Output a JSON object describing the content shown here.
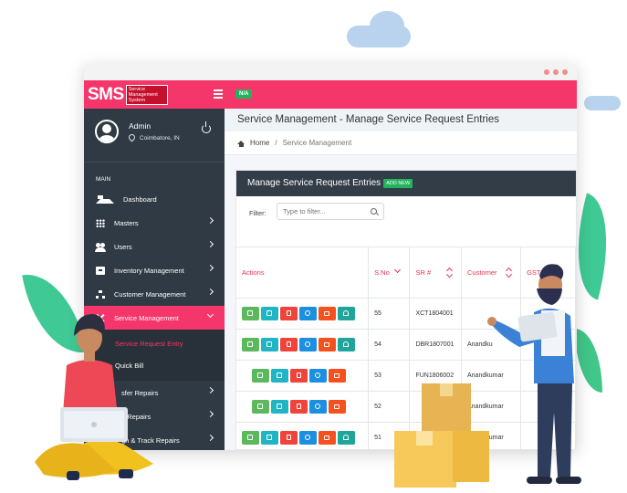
{
  "app": {
    "logo_text": "SMS",
    "logo_subtitle": "Service Management System",
    "status_badge": "N/A"
  },
  "profile": {
    "name": "Admin",
    "location": "Coimbatore, IN"
  },
  "sidebar": {
    "section_label": "MAIN",
    "items": [
      {
        "label": "Dashboard"
      },
      {
        "label": "Masters"
      },
      {
        "label": "Users"
      },
      {
        "label": "Inventory Management"
      },
      {
        "label": "Customer Management"
      },
      {
        "label": "Service Management"
      }
    ],
    "sub_items": [
      {
        "label": "Service Request Entry"
      },
      {
        "label": "Quick Bill"
      }
    ],
    "partial_items": [
      {
        "label": "sfer Repairs"
      },
      {
        "label": "e Repairs"
      },
      {
        "label": "gn & Track Repairs"
      }
    ]
  },
  "page": {
    "title": "Service Management - Manage Service Request Entries",
    "breadcrumb_home": "Home",
    "breadcrumb_sep": "/",
    "breadcrumb_current": "Service Management"
  },
  "card": {
    "title": "Manage Service Request Entries",
    "add_new_label": "ADD NEW",
    "filter_label": "Filter:",
    "filter_placeholder": "Type to filter..."
  },
  "table": {
    "columns": [
      "Actions",
      "S.No",
      "SR #",
      "Customer",
      "GST"
    ],
    "rows": [
      {
        "sno": "55",
        "sr": "XCT1804001",
        "customer": ""
      },
      {
        "sno": "54",
        "sr": "DBR1807001",
        "customer": "Anandku"
      },
      {
        "sno": "53",
        "sr": "FUN1806002",
        "customer": "Anandkumar"
      },
      {
        "sno": "52",
        "sr": "",
        "customer": "Anandkumar"
      },
      {
        "sno": "51",
        "sr": "",
        "customer": "Anandkumar"
      }
    ]
  },
  "colors": {
    "brand": "#f4366a",
    "sidebar_bg": "#2f3a44",
    "card_header": "#333d48",
    "add_new": "#23b35d"
  }
}
